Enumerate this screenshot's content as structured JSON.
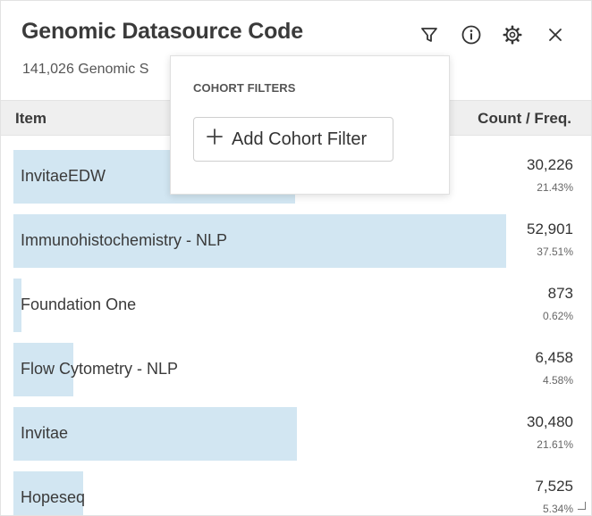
{
  "widget": {
    "title": "Genomic Datasource Code",
    "subtitle": "141,026 Genomic S"
  },
  "toolbar": {
    "filter_icon": "filter-icon",
    "info_icon": "info-icon",
    "settings_icon": "gear-icon",
    "close_icon": "close-icon"
  },
  "table": {
    "columns": {
      "item": "Item",
      "count": "Count / Freq."
    },
    "rows": [
      {
        "label": "InvitaeEDW",
        "count": "30,226",
        "pct": "21.43%",
        "fraction": 0.2143
      },
      {
        "label": "Immunohistochemistry - NLP",
        "count": "52,901",
        "pct": "37.51%",
        "fraction": 0.3751
      },
      {
        "label": "Foundation One",
        "count": "873",
        "pct": "0.62%",
        "fraction": 0.0062
      },
      {
        "label": "Flow Cytometry - NLP",
        "count": "6,458",
        "pct": "4.58%",
        "fraction": 0.0458
      },
      {
        "label": "Invitae",
        "count": "30,480",
        "pct": "21.61%",
        "fraction": 0.2161
      },
      {
        "label": "Hopeseq",
        "count": "7,525",
        "pct": "5.34%",
        "fraction": 0.0534
      }
    ]
  },
  "popover": {
    "heading": "COHORT FILTERS",
    "add_button_label": "Add Cohort Filter",
    "add_button_icon": "plus-icon"
  },
  "colors": {
    "bar": "#d2e6f2",
    "header_bg": "#efefef"
  }
}
